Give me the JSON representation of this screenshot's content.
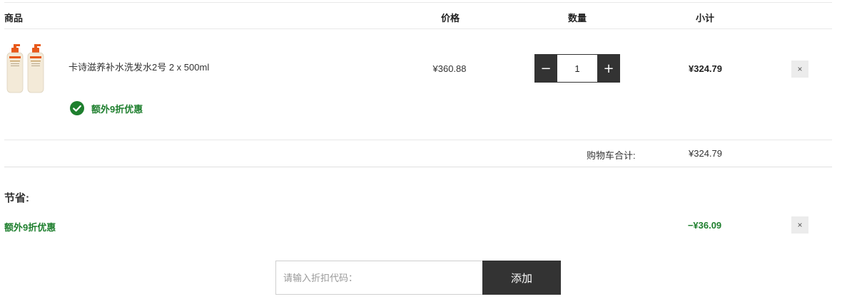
{
  "table_header": {
    "product": "商品",
    "price": "价格",
    "quantity": "数量",
    "subtotal": "小计"
  },
  "cart_item": {
    "image_icon": "shampoo-bottles-icon",
    "name": "卡诗滋养补水洗发水2号 2 x 500ml",
    "price": "¥360.88",
    "quantity": "1",
    "subtotal": "¥324.79",
    "promo_text": "额外9折优惠",
    "promo_icon": "check-circle-icon",
    "minus_label": "−",
    "plus_label": "+",
    "remove_label": "×"
  },
  "cart_total": {
    "label": "购物车合计:",
    "value": "¥324.79"
  },
  "savings": {
    "title": "节省:",
    "name": "额外9折优惠",
    "amount": "−¥36.09",
    "remove_label": "×"
  },
  "coupon": {
    "placeholder": "请输入折扣代码：",
    "button_label": "添加"
  },
  "colors": {
    "accent_dark": "#333333",
    "promo_green": "#1e7f2e",
    "bottle_orange": "#e8591a"
  }
}
